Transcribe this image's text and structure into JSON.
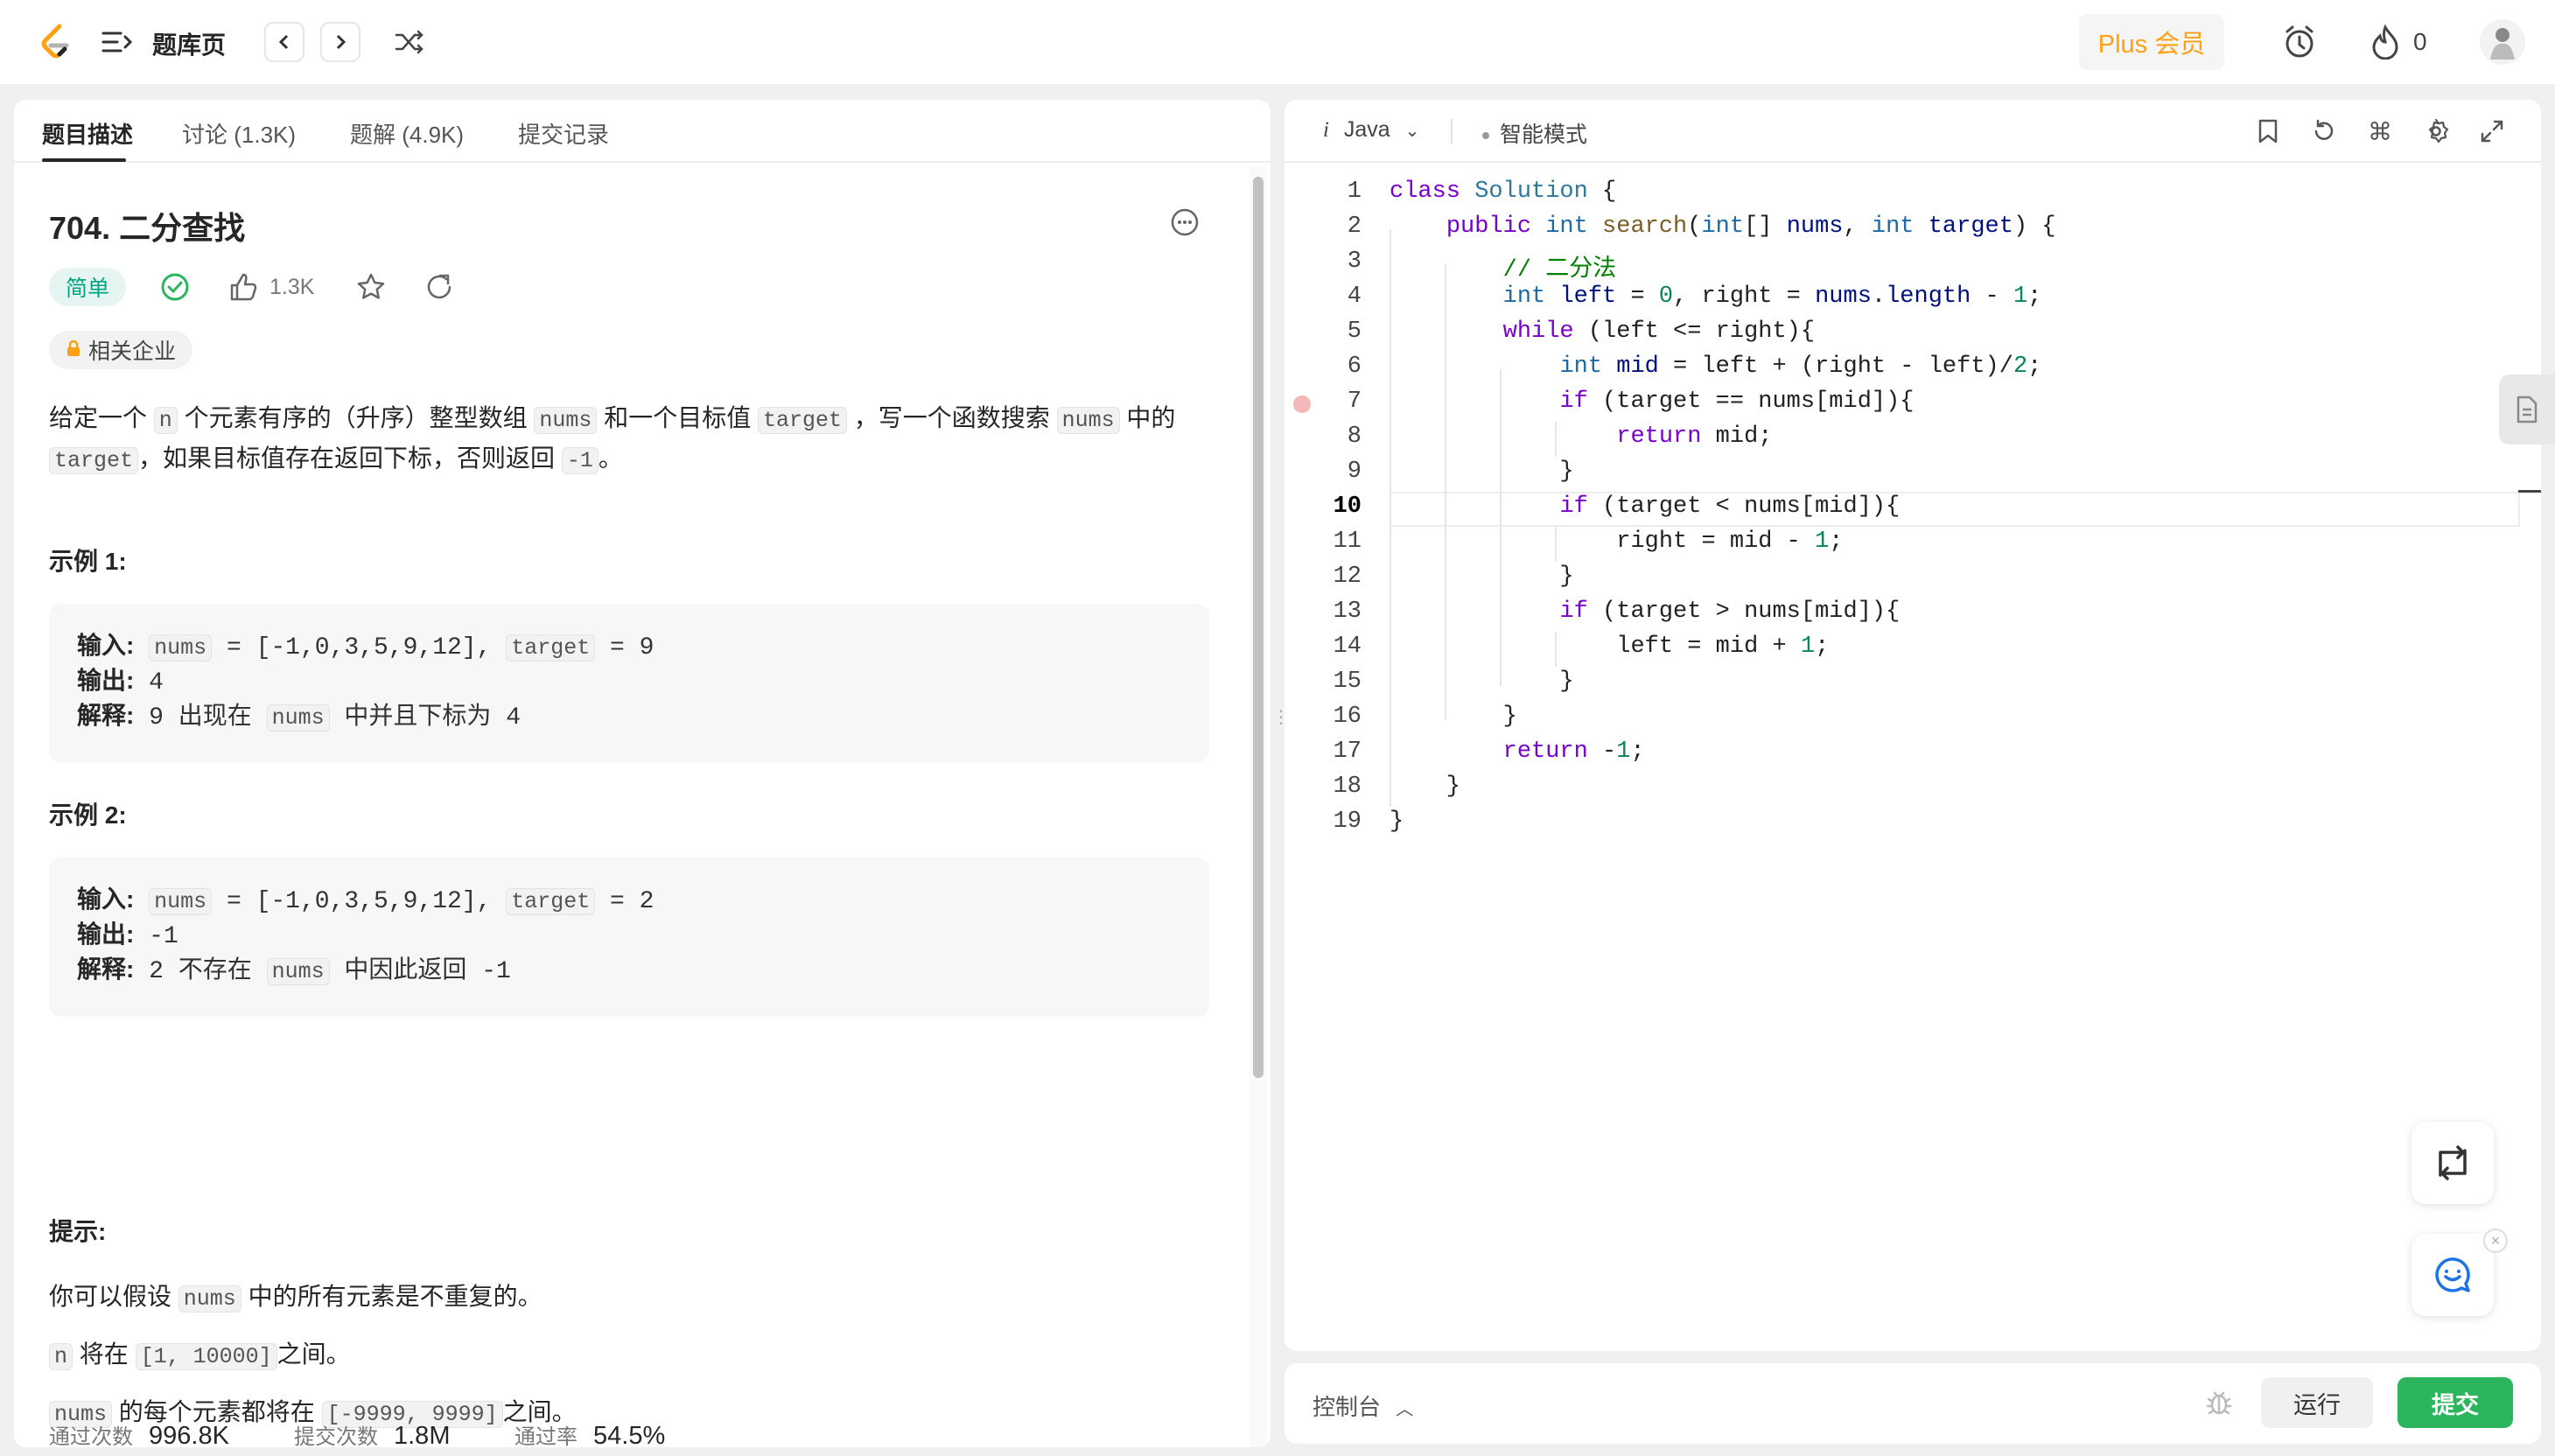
{
  "header": {
    "title": "题库页",
    "plus_label": "Plus 会员",
    "streak_count": "0",
    "colors": {
      "accent": "#ffa116",
      "brand": "#ffa116"
    }
  },
  "problem": {
    "tabs": [
      "题目描述",
      "讨论 (1.3K)",
      "题解 (4.9K)",
      "提交记录"
    ],
    "title": "704. 二分查找",
    "difficulty": "简单",
    "likes": "1.3K",
    "companies_label": "相关企业",
    "desc": {
      "p1_a": "给定一个",
      "p1_code1": "n",
      "p1_b": "个元素有序的（升序）整型数组",
      "p1_code2": "nums",
      "p1_c": "和一个目标值",
      "p1_code3": "target",
      "p1_d": "，写一个函数搜索",
      "p1_code4": "nums",
      "p1_e": "中的",
      "p2_code1": "target",
      "p2_a": "，如果目标值存在返回下标，否则返回",
      "p2_code2": "-1",
      "p2_b": "。"
    },
    "examples": [
      {
        "heading": "示例 1:",
        "input_label": "输入:",
        "input_nums_key": "nums",
        "input_nums_val": " = [-1,0,3,5,9,12],",
        "input_target_key": "target",
        "input_target_val": " = 9",
        "output_label": "输出:",
        "output_val": "4",
        "explain_label": "解释:",
        "explain_a": "9 出现在",
        "explain_code": "nums",
        "explain_b": "中并且下标为 4"
      },
      {
        "heading": "示例 2:",
        "input_label": "输入:",
        "input_nums_key": "nums",
        "input_nums_val": " = [-1,0,3,5,9,12],",
        "input_target_key": "target",
        "input_target_val": " = 2",
        "output_label": "输出:",
        "output_val": "-1",
        "explain_label": "解释:",
        "explain_a": "2 不存在",
        "explain_code": "nums",
        "explain_b": "中因此返回 -1"
      }
    ],
    "tips_heading": "提示:",
    "tips": [
      {
        "a": "你可以假设",
        "code": "nums",
        "b": "中的所有元素是不重复的。"
      },
      {
        "a": "",
        "code": "n",
        "b": "将在",
        "code2": "[1, 10000]",
        "c": "之间。"
      },
      {
        "a": "",
        "code": "nums",
        "b": "的每个元素都将在",
        "code2": "[-9999, 9999]",
        "c": "之间。"
      }
    ],
    "stats": [
      {
        "label": "通过次数",
        "value": "996.8K"
      },
      {
        "label": "提交次数",
        "value": "1.8M"
      },
      {
        "label": "通过率",
        "value": "54.5%"
      }
    ]
  },
  "editor": {
    "language": "Java",
    "mode": "智能模式",
    "current_line": 10,
    "breakpoint_line": 7,
    "lines": [
      "class Solution {",
      "    public int search(int[] nums, int target) {",
      "        // 二分法",
      "        int left = 0, right = nums.length - 1;",
      "        while (left <= right){",
      "            int mid = left + (right - left)/2;",
      "            if (target == nums[mid]){",
      "                return mid;",
      "            }",
      "            if (target < nums[mid]){",
      "                right = mid - 1;",
      "            }",
      "            if (target > nums[mid]){",
      "                left = mid + 1;",
      "            }",
      "        }",
      "        return -1;",
      "    }",
      "}"
    ]
  },
  "console": {
    "label": "控制台",
    "run_label": "运行",
    "submit_label": "提交",
    "submit_color": "#2db55d"
  }
}
